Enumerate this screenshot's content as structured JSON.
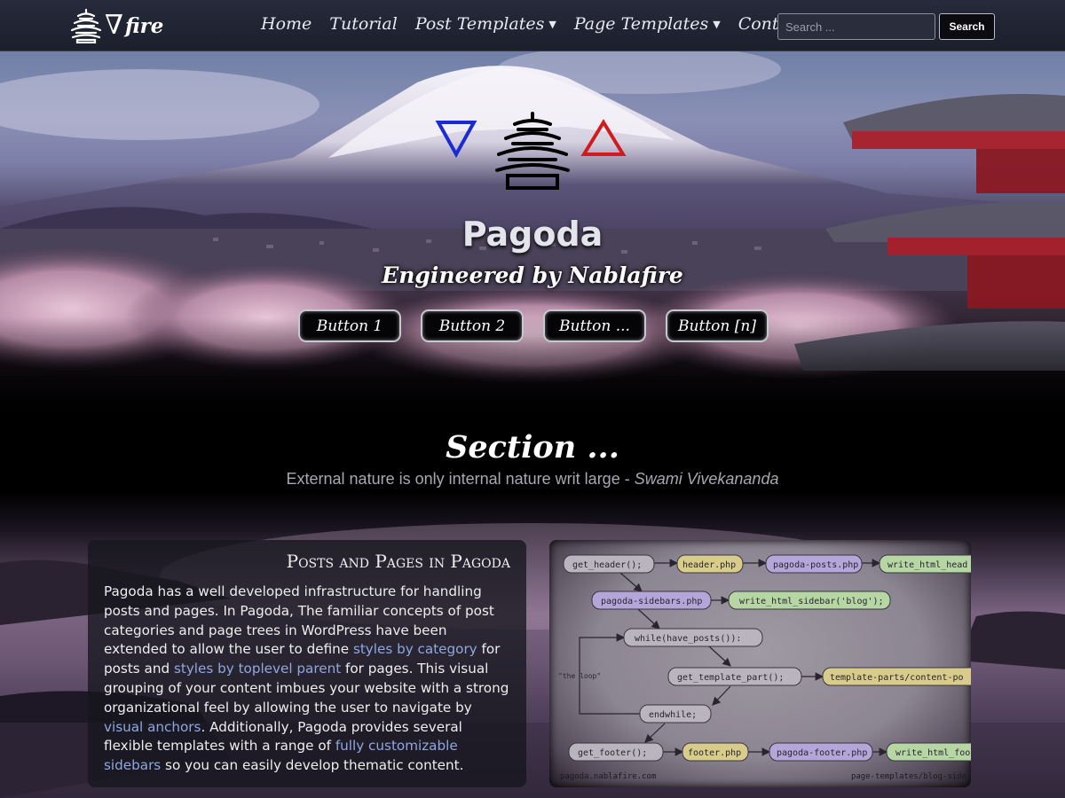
{
  "nav": {
    "brand_symbol": "∇",
    "brand_text": "fire",
    "links": [
      {
        "label": "Home",
        "dropdown": false
      },
      {
        "label": "Tutorial",
        "dropdown": false
      },
      {
        "label": "Post Templates",
        "dropdown": true
      },
      {
        "label": "Page Templates",
        "dropdown": true
      },
      {
        "label": "Contact",
        "dropdown": false
      }
    ],
    "search_placeholder": "Search ...",
    "search_button": "Search"
  },
  "hero": {
    "title": "Pagoda",
    "tagline": "Engineered by Nablafire",
    "buttons": [
      "Button 1",
      "Button 2",
      "Button ...",
      "Button [n]"
    ]
  },
  "section": {
    "title": "Section ...",
    "quote": "External nature is only internal nature writ large - ",
    "quote_author": "Swami Vivekananda"
  },
  "card": {
    "title": "Posts and Pages in Pagoda",
    "p1": "Pagoda has a well developed infrastructure for handling posts and pages. In Pagoda, The familiar concepts of post categories and page trees in WordPress have been extended to allow the user to define ",
    "link1": "styles by category",
    "p2": " for posts and ",
    "link2": "styles by toplevel parent",
    "p3": " for pages. This visual grouping of your content imbues your website with a strong organizational feel by allowing the user to navigate by ",
    "link3": "visual anchors",
    "p4": ". Additionally, Pagoda provides several flexible templates with a range of ",
    "link4": "fully customizable sidebars",
    "p5": " so you can easily develop thematic content."
  },
  "diagram": {
    "nodes": {
      "get_header": "get_header();",
      "header_php": "header.php",
      "pagoda_posts": "pagoda-posts.php",
      "write_head": "write_html_head",
      "pagoda_sidebars": "pagoda-sidebars.php",
      "write_sidebar": "write_html_sidebar('blog');",
      "while": "while(have_posts()):",
      "get_template_part": "get_template_part();",
      "content_part": "template-parts/content-po",
      "endwhile": "endwhile;",
      "get_footer": "get_footer();",
      "footer_php": "footer.php",
      "pagoda_footer": "pagoda-footer.php",
      "write_foot": "write_html_foo"
    },
    "loop_label": "\"the loop\"",
    "footer_left": "pagoda.nablafire.com",
    "footer_right": "page-templates/blog-side"
  },
  "colors": {
    "nabla_blue": "#1c2bd0",
    "delta_red": "#d01c1c",
    "link": "#8fa8e0",
    "node_gray": "#b9b4bd",
    "node_yellow": "#d8cc8a",
    "node_purple": "#b4a6d8",
    "node_green": "#b6d6a4"
  }
}
